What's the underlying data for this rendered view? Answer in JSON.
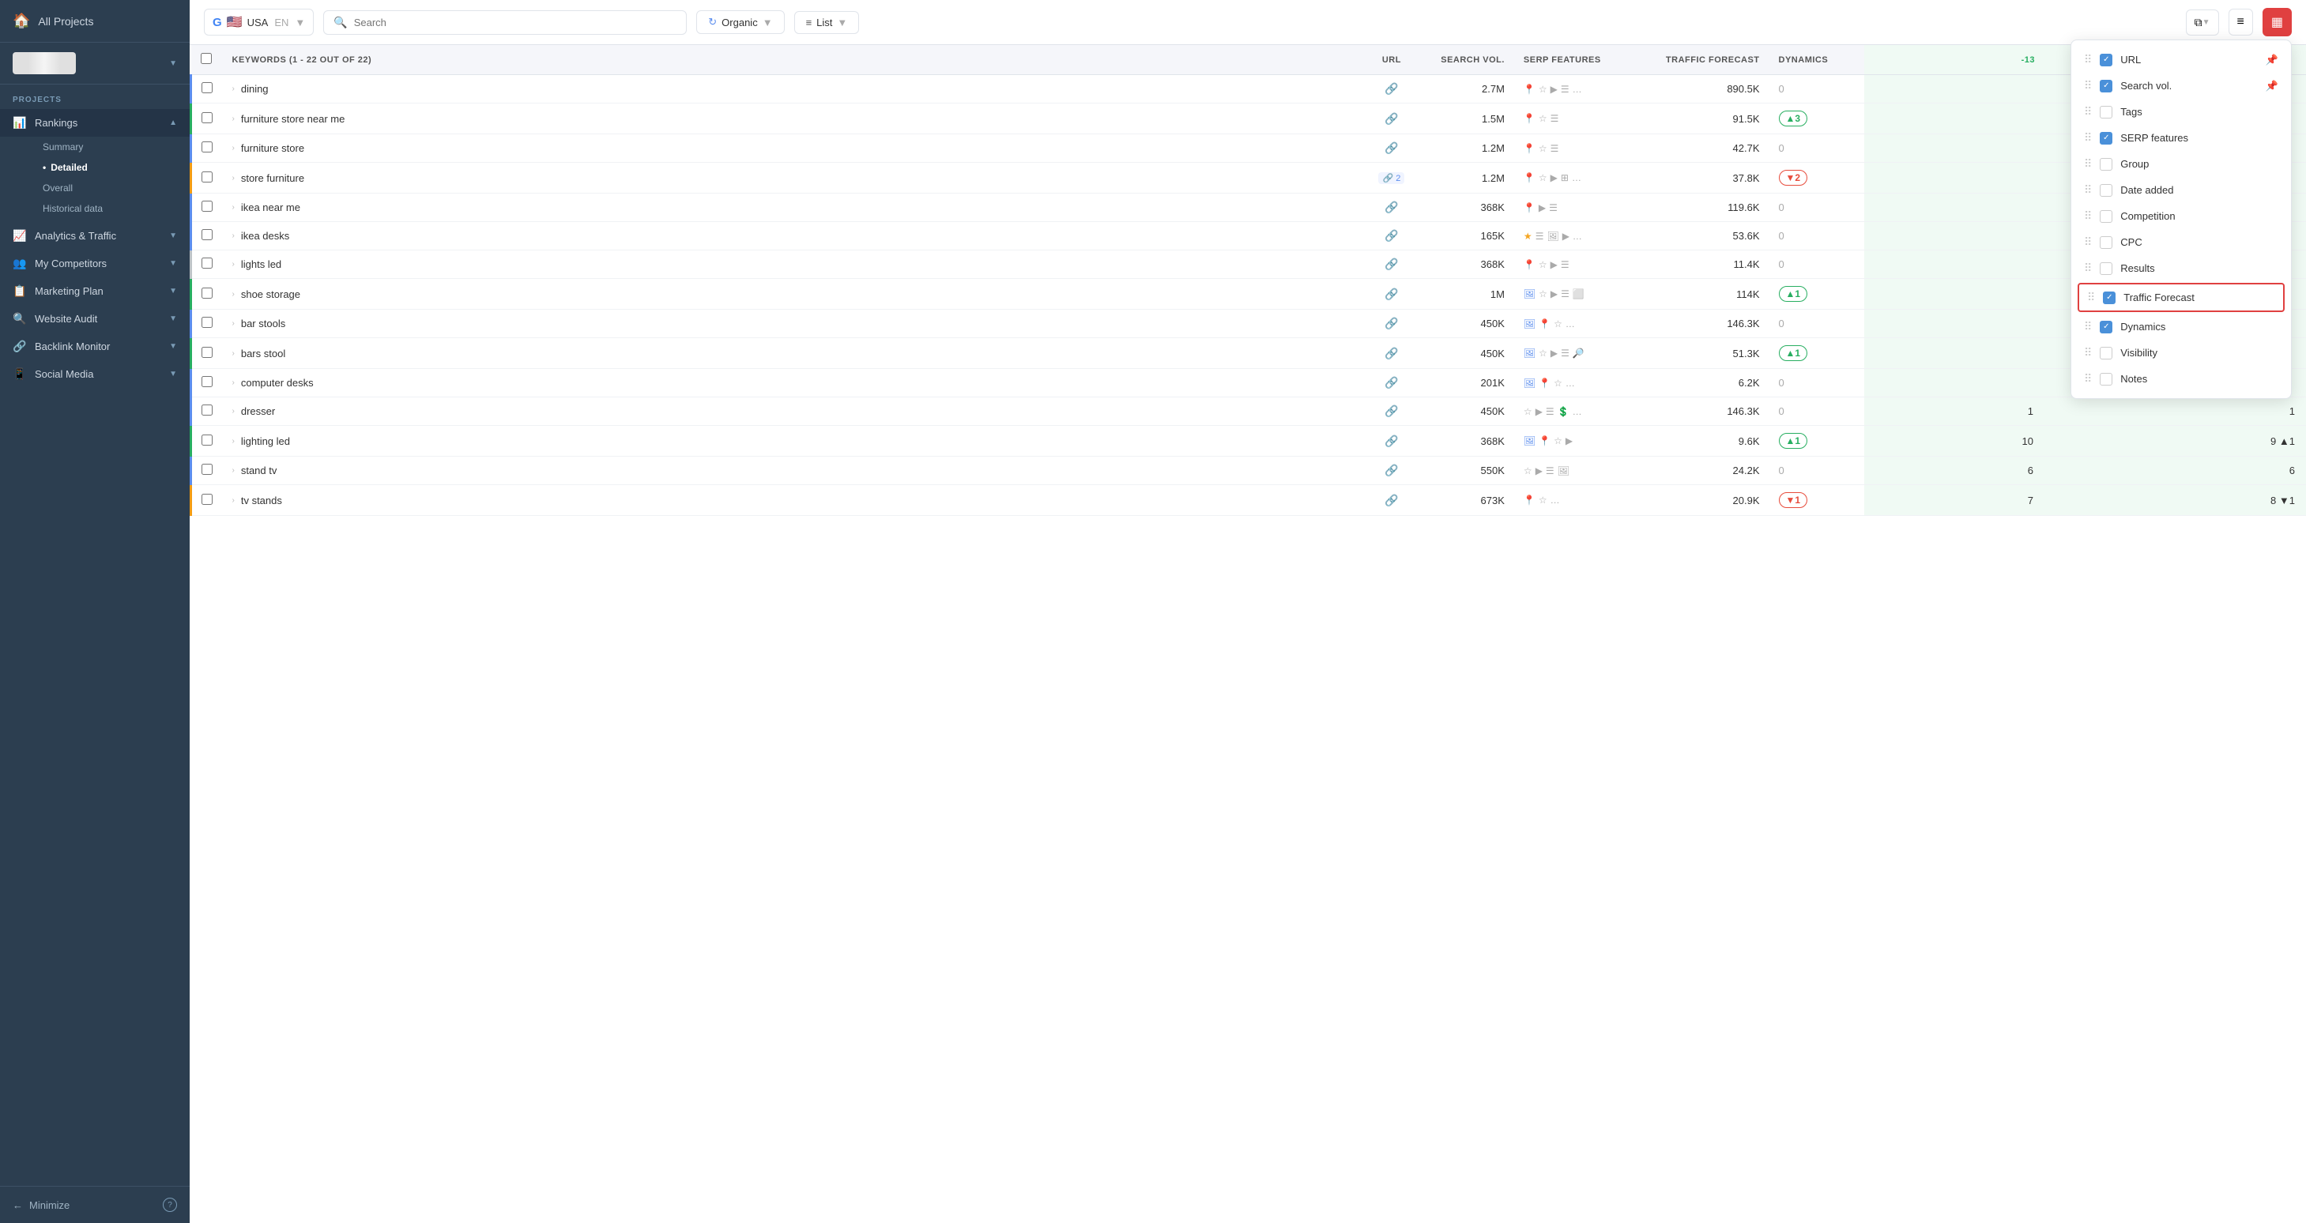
{
  "sidebar": {
    "header": {
      "icon": "🏠",
      "label": "All Projects"
    },
    "account_thumbnail": "",
    "section_label": "PROJECTS",
    "items": [
      {
        "id": "rankings",
        "icon": "📊",
        "label": "Rankings",
        "arrow": "▲",
        "active": true,
        "sub_items": [
          {
            "id": "summary",
            "label": "Summary",
            "active": false,
            "dot": false
          },
          {
            "id": "detailed",
            "label": "Detailed",
            "active": true,
            "dot": true
          },
          {
            "id": "overall",
            "label": "Overall",
            "active": false,
            "dot": false
          },
          {
            "id": "historical",
            "label": "Historical data",
            "active": false,
            "dot": false
          }
        ]
      },
      {
        "id": "analytics",
        "icon": "📈",
        "label": "Analytics & Traffic",
        "arrow": "▼",
        "active": false
      },
      {
        "id": "competitors",
        "icon": "👥",
        "label": "My Competitors",
        "arrow": "▼",
        "active": false
      },
      {
        "id": "marketing",
        "icon": "📋",
        "label": "Marketing Plan",
        "arrow": "▼",
        "active": false
      },
      {
        "id": "audit",
        "icon": "🔍",
        "label": "Website Audit",
        "arrow": "▼",
        "active": false
      },
      {
        "id": "backlink",
        "icon": "🔗",
        "label": "Backlink Monitor",
        "arrow": "▼",
        "active": false
      },
      {
        "id": "social",
        "icon": "📱",
        "label": "Social Media",
        "arrow": "▼",
        "active": false
      }
    ],
    "minimize_label": "Minimize"
  },
  "toolbar": {
    "google_icon": "G",
    "flag": "🇺🇸",
    "country": "USA",
    "lang": "EN",
    "search_placeholder": "Search",
    "organic_label": "Organic",
    "list_label": "List",
    "copy_icon": "⧉",
    "filter_icon": "≡",
    "grid_icon": "▦"
  },
  "table": {
    "header": {
      "select_all": "",
      "keywords_col": "KEYWORDS (1 - 22 OUT OF 22)",
      "url_col": "URL",
      "searchvol_col": "SEARCH VOL.",
      "serp_col": "SERP FEATURES",
      "traffic_col": "TRAFFIC FORECAST",
      "dynamics_col": "DYNAMICS",
      "col_minus13": "-13",
      "col_last1": "",
      "col_last2": ""
    },
    "rows": [
      {
        "id": 1,
        "keyword": "dining",
        "url_links": 1,
        "search_vol": "2.7M",
        "serp": [
          "pin",
          "star",
          "video",
          "list",
          "more"
        ],
        "traffic": "890.5K",
        "dynamics": "0",
        "dynamics_type": "zero",
        "col1": "",
        "col2": "",
        "bar": "blue"
      },
      {
        "id": 2,
        "keyword": "furniture store near me",
        "url_links": 1,
        "search_vol": "1.5M",
        "serp": [
          "pin",
          "star",
          "list"
        ],
        "traffic": "91.5K",
        "dynamics": "▲3",
        "dynamics_type": "up",
        "col1": "",
        "col2": "",
        "bar": "green"
      },
      {
        "id": 3,
        "keyword": "furniture store",
        "url_links": 1,
        "search_vol": "1.2M",
        "serp": [
          "pin",
          "star",
          "list"
        ],
        "traffic": "42.7K",
        "dynamics": "0",
        "dynamics_type": "zero",
        "col1": "",
        "col2": "",
        "bar": "blue"
      },
      {
        "id": 4,
        "keyword": "store furniture",
        "url_links": 2,
        "search_vol": "1.2M",
        "serp": [
          "pin",
          "star",
          "video",
          "grid",
          "more"
        ],
        "traffic": "37.8K",
        "dynamics": "▼2",
        "dynamics_type": "down",
        "col1": "",
        "col2": "",
        "bar": "orange"
      },
      {
        "id": 5,
        "keyword": "ikea near me",
        "url_links": 1,
        "search_vol": "368K",
        "serp": [
          "pin_blue",
          "video",
          "list"
        ],
        "traffic": "119.6K",
        "dynamics": "0",
        "dynamics_type": "zero",
        "col1": "",
        "col2": "",
        "bar": "blue"
      },
      {
        "id": 6,
        "keyword": "ikea desks",
        "url_links": 1,
        "search_vol": "165K",
        "serp": [
          "star_gold",
          "list",
          "img",
          "video",
          "more"
        ],
        "traffic": "53.6K",
        "dynamics": "0",
        "dynamics_type": "zero",
        "col1": "",
        "col2": "",
        "bar": "blue"
      },
      {
        "id": 7,
        "keyword": "lights led",
        "url_links": 1,
        "search_vol": "368K",
        "serp": [
          "pin",
          "star",
          "video",
          "list"
        ],
        "traffic": "11.4K",
        "dynamics": "0",
        "dynamics_type": "zero",
        "col1": "",
        "col2": "",
        "bar": "gray"
      },
      {
        "id": 8,
        "keyword": "shoe storage",
        "url_links": 1,
        "search_vol": "1M",
        "serp": [
          "img_blue",
          "star",
          "video",
          "list",
          "square"
        ],
        "traffic": "114K",
        "dynamics": "▲1",
        "dynamics_type": "up",
        "col1": "",
        "col2": "",
        "bar": "green"
      },
      {
        "id": 9,
        "keyword": "bar stools",
        "url_links": 1,
        "search_vol": "450K",
        "serp": [
          "img_blue",
          "pin",
          "star",
          "more"
        ],
        "traffic": "146.3K",
        "dynamics": "0",
        "dynamics_type": "zero",
        "col1": "",
        "col2": "",
        "bar": "blue"
      },
      {
        "id": 10,
        "keyword": "bars stool",
        "url_links": 1,
        "search_vol": "450K",
        "serp": [
          "img_blue",
          "star",
          "video",
          "list",
          "zoom"
        ],
        "traffic": "51.3K",
        "dynamics": "▲1",
        "dynamics_type": "up",
        "col1": "",
        "col2": "",
        "bar": "green"
      },
      {
        "id": 11,
        "keyword": "computer desks",
        "url_links": 1,
        "search_vol": "201K",
        "serp": [
          "img_blue",
          "pin",
          "star",
          "more"
        ],
        "traffic": "6.2K",
        "dynamics": "0",
        "dynamics_type": "zero",
        "col1": "",
        "col2": "",
        "bar": "blue"
      },
      {
        "id": 12,
        "keyword": "dresser",
        "url_links": 1,
        "search_vol": "450K",
        "serp": [
          "star",
          "video",
          "list",
          "dollar",
          "more"
        ],
        "traffic": "146.3K",
        "dynamics": "0",
        "dynamics_type": "zero",
        "col1": "1",
        "col2": "1",
        "bar": "blue"
      },
      {
        "id": 13,
        "keyword": "lighting led",
        "url_links": 1,
        "search_vol": "368K",
        "serp": [
          "img_blue",
          "pin",
          "star",
          "video"
        ],
        "traffic": "9.6K",
        "dynamics": "▲1",
        "dynamics_type": "up",
        "col1": "10",
        "col2": "9 ▲1",
        "bar": "green"
      },
      {
        "id": 14,
        "keyword": "stand tv",
        "url_links": 1,
        "search_vol": "550K",
        "serp": [
          "star",
          "video",
          "list",
          "img"
        ],
        "traffic": "24.2K",
        "dynamics": "0",
        "dynamics_type": "zero",
        "col1": "6",
        "col2": "6",
        "bar": "blue"
      },
      {
        "id": 15,
        "keyword": "tv stands",
        "url_links": 1,
        "search_vol": "673K",
        "serp": [
          "pin",
          "star",
          "more"
        ],
        "traffic": "20.9K",
        "dynamics": "▼1",
        "dynamics_type": "down",
        "col1": "7",
        "col2": "8 ▼1",
        "bar": "orange"
      }
    ]
  },
  "dropdown_panel": {
    "items": [
      {
        "id": "url",
        "label": "URL",
        "checked": true,
        "pinned": true
      },
      {
        "id": "searchvol",
        "label": "Search vol.",
        "checked": true,
        "pinned": true
      },
      {
        "id": "tags",
        "label": "Tags",
        "checked": false,
        "pinned": false
      },
      {
        "id": "serp",
        "label": "SERP features",
        "checked": true,
        "pinned": false
      },
      {
        "id": "group",
        "label": "Group",
        "checked": false,
        "pinned": false
      },
      {
        "id": "dateadded",
        "label": "Date added",
        "checked": false,
        "pinned": false
      },
      {
        "id": "competition",
        "label": "Competition",
        "checked": false,
        "pinned": false
      },
      {
        "id": "cpc",
        "label": "CPC",
        "checked": false,
        "pinned": false
      },
      {
        "id": "results",
        "label": "Results",
        "checked": false,
        "pinned": false
      },
      {
        "id": "trafficforecast",
        "label": "Traffic Forecast",
        "checked": true,
        "pinned": false,
        "highlighted": true
      },
      {
        "id": "dynamics",
        "label": "Dynamics",
        "checked": true,
        "pinned": false
      },
      {
        "id": "visibility",
        "label": "Visibility",
        "checked": false,
        "pinned": false
      },
      {
        "id": "notes",
        "label": "Notes",
        "checked": false,
        "pinned": false
      }
    ]
  }
}
